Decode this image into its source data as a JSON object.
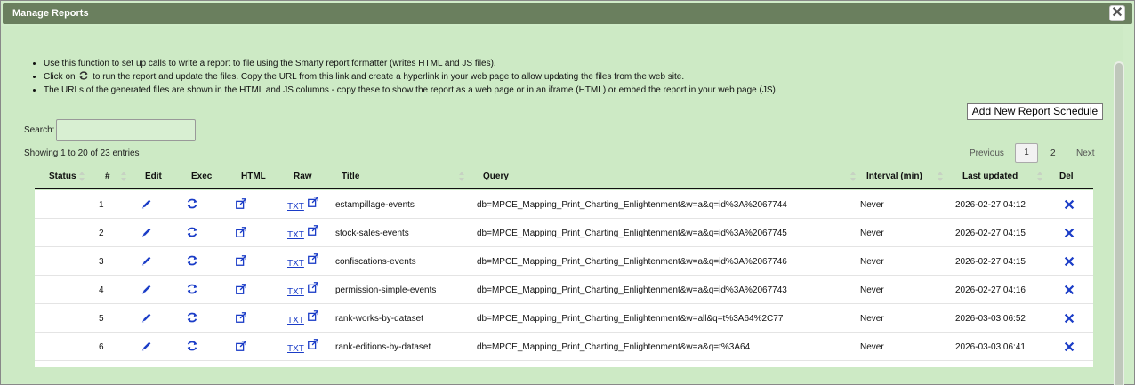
{
  "dialog": {
    "title": "Manage Reports",
    "close_glyph": "✕"
  },
  "info": {
    "line1": "Use this function to set up calls to write a report to file using the Smarty report formatter (writes HTML and JS files).",
    "line2_pre": "Click on",
    "line2_post": "to run the report and update the files. Copy the URL from this link and create a hyperlink in your web page to allow updating the files from the web site.",
    "line3": "The URLs of the generated files are shown in the HTML and JS columns - copy these to show the report as a web page or in an iframe (HTML) or embed the report in your web page (JS)."
  },
  "add_button": "Add New Report Schedule",
  "search": {
    "label": "Search:",
    "value": ""
  },
  "showing": "Showing 1 to 20 of 23 entries",
  "pagination": {
    "previous": "Previous",
    "pages": [
      "1",
      "2"
    ],
    "next": "Next",
    "current": "1"
  },
  "table": {
    "headers": {
      "status": "Status",
      "num": "#",
      "edit": "Edit",
      "exec": "Exec",
      "html": "HTML",
      "raw": "Raw",
      "title": "Title",
      "query": "Query",
      "interval": "Interval (min)",
      "updated": "Last updated",
      "del": "Del"
    },
    "rows": [
      {
        "num": "1",
        "raw": "TXT",
        "title": "estampillage-events",
        "query": "db=MPCE_Mapping_Print_Charting_Enlightenment&w=a&q=id%3A%2067744",
        "interval": "Never",
        "updated": "2026-02-27 04:12"
      },
      {
        "num": "2",
        "raw": "TXT",
        "title": "stock-sales-events",
        "query": "db=MPCE_Mapping_Print_Charting_Enlightenment&w=a&q=id%3A%2067745",
        "interval": "Never",
        "updated": "2026-02-27 04:15"
      },
      {
        "num": "3",
        "raw": "TXT",
        "title": "confiscations-events",
        "query": "db=MPCE_Mapping_Print_Charting_Enlightenment&w=a&q=id%3A%2067746",
        "interval": "Never",
        "updated": "2026-02-27 04:15"
      },
      {
        "num": "4",
        "raw": "TXT",
        "title": "permission-simple-events",
        "query": "db=MPCE_Mapping_Print_Charting_Enlightenment&w=a&q=id%3A%2067743",
        "interval": "Never",
        "updated": "2026-02-27 04:16"
      },
      {
        "num": "5",
        "raw": "TXT",
        "title": "rank-works-by-dataset",
        "query": "db=MPCE_Mapping_Print_Charting_Enlightenment&w=all&q=t%3A64%2C77",
        "interval": "Never",
        "updated": "2026-03-03 06:52"
      },
      {
        "num": "6",
        "raw": "TXT",
        "title": "rank-editions-by-dataset",
        "query": "db=MPCE_Mapping_Print_Charting_Enlightenment&w=a&q=t%3A64",
        "interval": "Never",
        "updated": "2026-03-03 06:41"
      }
    ]
  },
  "colors": {
    "titlebar": "#6a7f5e",
    "panel": "#cdeac5",
    "icon_blue": "#1a3cc7"
  },
  "icons": {
    "edit": "pencil-icon",
    "exec": "refresh-icon",
    "html": "external-link-icon",
    "raw": "external-link-icon",
    "del": "delete-x-icon"
  }
}
